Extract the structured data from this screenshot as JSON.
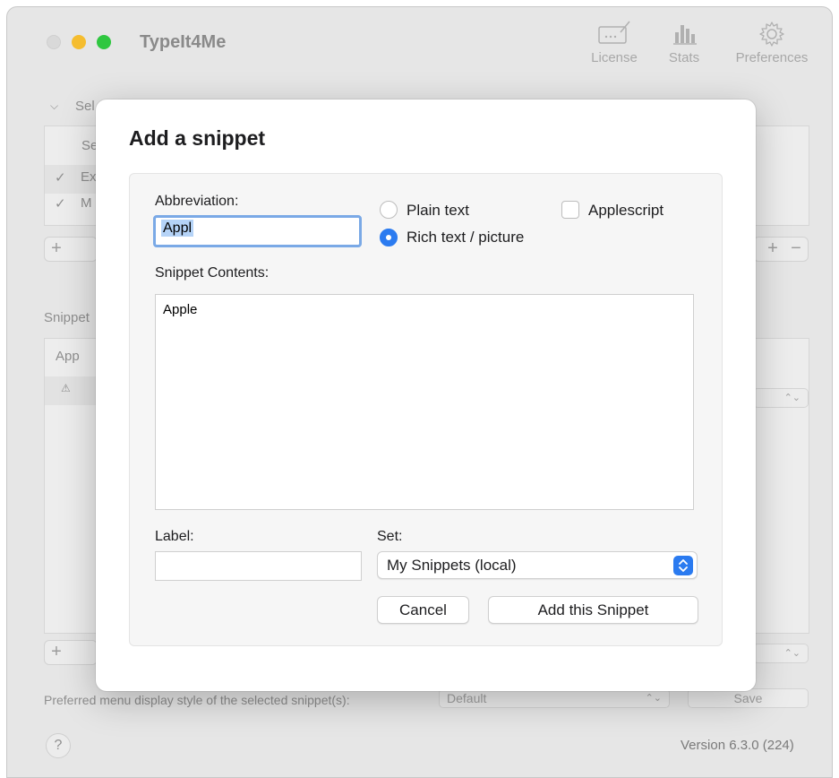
{
  "app": {
    "title": "TypeIt4Me",
    "toolbar": {
      "license": "License",
      "stats": "Stats",
      "preferences": "Preferences"
    },
    "sets_header": "Sel",
    "sets_column": "Se",
    "sets_rows": [
      "Ex",
      "M"
    ],
    "snippets_label": "Snippet",
    "snippets_column": "App",
    "menu_style_label": "Preferred menu display style of the selected snippet(s):",
    "menu_style_value": "Default",
    "save_label": "Save",
    "help_label": "?",
    "version": "Version 6.3.0 (224)",
    "add_symbol": "+",
    "remove_symbol": "−"
  },
  "dialog": {
    "title": "Add a snippet",
    "abbreviation_label": "Abbreviation:",
    "abbreviation_value": "Appl",
    "format_options": [
      {
        "label": "Plain text",
        "selected": false
      },
      {
        "label": "Rich text / picture",
        "selected": true
      }
    ],
    "applescript_label": "Applescript",
    "applescript_checked": false,
    "contents_label": "Snippet Contents:",
    "contents_value": "Apple",
    "label_label": "Label:",
    "label_value": "",
    "set_label": "Set:",
    "set_value": "My Snippets (local)",
    "cancel_label": "Cancel",
    "add_label": "Add this Snippet"
  },
  "colors": {
    "accent": "#2b7bf0",
    "focus_ring": "#7aa9e6",
    "selection": "#b5d3f7"
  }
}
